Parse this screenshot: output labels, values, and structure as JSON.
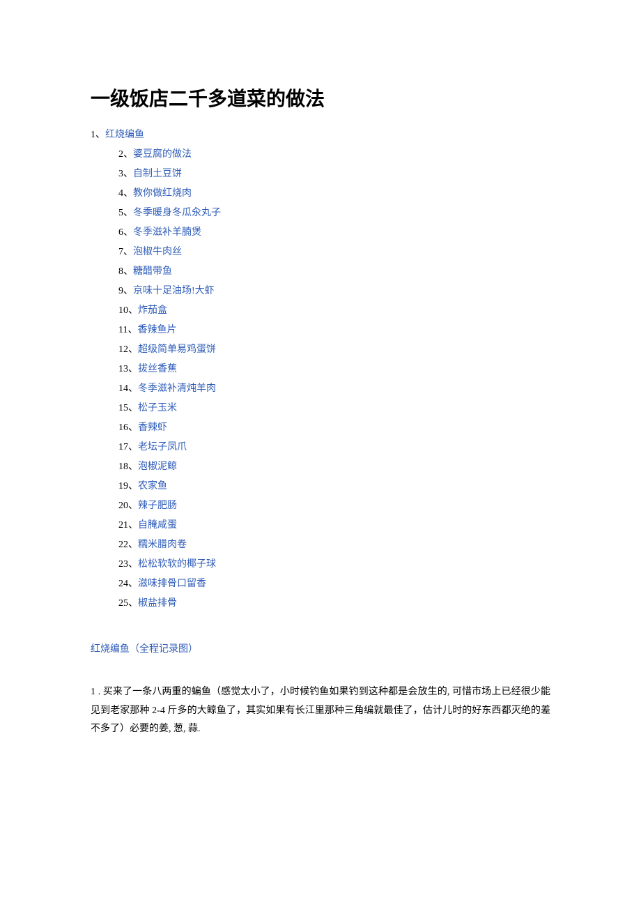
{
  "title": "一级饭店二千多道菜的做法",
  "first_item": {
    "num": "1、",
    "label": "红烧编鱼"
  },
  "items": [
    {
      "num": "2、",
      "label": "婆豆腐的做法"
    },
    {
      "num": "3、",
      "label": "自制土豆饼"
    },
    {
      "num": "4、",
      "label": "教你做红烧肉"
    },
    {
      "num": "5、",
      "label": "冬季暖身冬瓜汆丸子"
    },
    {
      "num": "6、",
      "label": "冬季滋补羊腩煲"
    },
    {
      "num": "7、",
      "label": "泡椒牛肉丝"
    },
    {
      "num": "8、",
      "label": "糖醋带鱼"
    },
    {
      "num": "9、",
      "label": "京味十足油场!大虾"
    },
    {
      "num": "10、",
      "label": "炸茄盒"
    },
    {
      "num": "11、",
      "label": "香辣鱼片"
    },
    {
      "num": "12、",
      "label": "超级简单易鸡蛋饼"
    },
    {
      "num": "13、",
      "label": "拔丝香蕉"
    },
    {
      "num": "14、",
      "label": "冬季滋补清炖羊肉"
    },
    {
      "num": "15、",
      "label": "松子玉米"
    },
    {
      "num": "16、",
      "label": "香辣虾"
    },
    {
      "num": "17、",
      "label": "老坛子凤爪"
    },
    {
      "num": "18、",
      "label": "泡椒泥鲸"
    },
    {
      "num": "19、",
      "label": "农家鱼"
    },
    {
      "num": "20、",
      "label": "辣子肥肠"
    },
    {
      "num": "21、",
      "label": "自腌咸蛋"
    },
    {
      "num": "22、",
      "label": "糯米腊肉卷"
    },
    {
      "num": "23、",
      "label": "松松软软的椰子球"
    },
    {
      "num": "24、",
      "label": "滋味排骨口留香"
    },
    {
      "num": "25、",
      "label": "椒盐排骨"
    }
  ],
  "section_heading": "红烧编鱼（全程记录图）",
  "body_paragraph": "1 . 买来了一条八两重的蝙鱼（感觉太小了，小时候钓鱼如果钓到这种都是会放生的, 可惜市场上已经很少能见到老家那种 2-4 斤多的大鲸鱼了，其实如果有长江里那种三角编就最佳了，估计儿时的好东西都灭绝的差不多了）必要的姜, 葱, 蒜."
}
